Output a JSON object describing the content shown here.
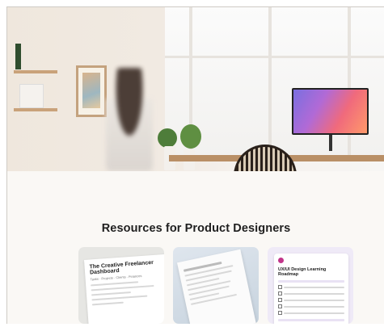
{
  "section": {
    "title": "Resources for Product Designers"
  },
  "cards": [
    {
      "title": "The Creative Freelancer Dashboard",
      "subtitle": "Tasks · Projects · Clients · Finances"
    },
    {
      "title": ""
    },
    {
      "title": "UX/UI Design Learning Roadmap"
    }
  ],
  "colors": {
    "background": "#faf8f5",
    "title": "#1f1f1f"
  }
}
